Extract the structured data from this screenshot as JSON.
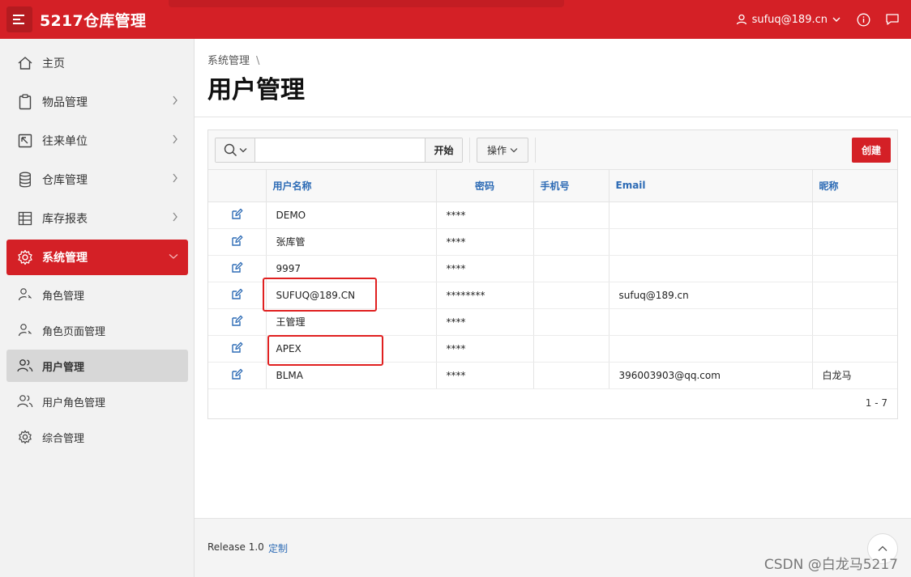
{
  "app": {
    "title": "5217仓库管理"
  },
  "header": {
    "user": "sufuq@189.cn"
  },
  "sidebar": {
    "items": [
      {
        "label": "主页"
      },
      {
        "label": "物品管理"
      },
      {
        "label": "往来单位"
      },
      {
        "label": "仓库管理"
      },
      {
        "label": "库存报表"
      },
      {
        "label": "系统管理"
      }
    ],
    "subitems": [
      {
        "label": "角色管理"
      },
      {
        "label": "角色页面管理"
      },
      {
        "label": "用户管理"
      },
      {
        "label": "用户角色管理"
      },
      {
        "label": "综合管理"
      }
    ]
  },
  "breadcrumb": {
    "parent": "系统管理",
    "sep": "\\"
  },
  "page": {
    "title": "用户管理"
  },
  "toolbar": {
    "search_value": "",
    "go_label": "开始",
    "actions_label": "操作",
    "create_label": "创建"
  },
  "table": {
    "headers": [
      "用户名称",
      "密码",
      "手机号",
      "Email",
      "昵称"
    ],
    "rows": [
      {
        "name": "DEMO",
        "password": "****",
        "phone": "",
        "email": "",
        "nickname": ""
      },
      {
        "name": "张库管",
        "password": "****",
        "phone": "",
        "email": "",
        "nickname": ""
      },
      {
        "name": "9997",
        "password": "****",
        "phone": "",
        "email": "",
        "nickname": ""
      },
      {
        "name": "SUFUQ@189.CN",
        "password": "********",
        "phone": "",
        "email": "sufuq@189.cn",
        "nickname": ""
      },
      {
        "name": "王管理",
        "password": "****",
        "phone": "",
        "email": "",
        "nickname": ""
      },
      {
        "name": "APEX",
        "password": "****",
        "phone": "",
        "email": "",
        "nickname": ""
      },
      {
        "name": "BLMA",
        "password": "****",
        "phone": "",
        "email": "396003903@qq.com",
        "nickname": "白龙马"
      }
    ]
  },
  "pagination": {
    "label": "1 - 7"
  },
  "footer": {
    "release": "Release 1.0",
    "customize": "定制"
  },
  "watermark": "CSDN @白龙马5217",
  "colors": {
    "brand": "#d42026",
    "link": "#2d6bb5",
    "highlight": "#e02020"
  }
}
